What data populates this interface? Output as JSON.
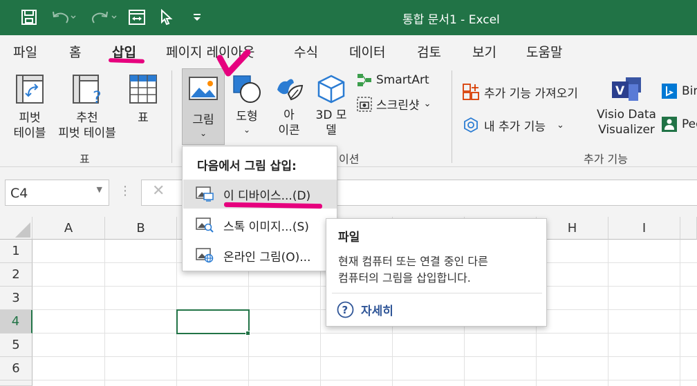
{
  "window": {
    "title": "통합 문서1  -  Excel"
  },
  "tabs": [
    {
      "label": "파일"
    },
    {
      "label": "홈"
    },
    {
      "label": "삽입"
    },
    {
      "label": "페이지 레이아웃"
    },
    {
      "label": "수식"
    },
    {
      "label": "데이터"
    },
    {
      "label": "검토"
    },
    {
      "label": "보기"
    },
    {
      "label": "도움말"
    }
  ],
  "ribbon": {
    "pivot_label": "피벗\n테이블",
    "recommended_label": "추천\n피벗 테이블",
    "table_label": "표",
    "group_table": "표",
    "pictures_label": "그림",
    "shapes_label": "도형",
    "icons_label": "아\n이콘",
    "model3d_label": "3D 모\n델",
    "smartart_label": "SmartArt",
    "screenshot_label": "스크린샷",
    "group_illustrations_suffix": "이션",
    "get_addins_label": "추가 기능 가져오기",
    "my_addins_label": "내 추가 기능",
    "visio_label": "Visio Data\nVisualizer",
    "bing_label": "Bin",
    "people_label": "Peo",
    "group_addins": "추가 기능"
  },
  "formula_bar": {
    "name_box": "C4"
  },
  "columns": [
    "A",
    "B",
    "H",
    "I"
  ],
  "rows": [
    "1",
    "2",
    "3",
    "4",
    "5",
    "6"
  ],
  "dropdown": {
    "header": "다음에서 그림 삽입:",
    "items": [
      {
        "label": "이 디바이스...(D)"
      },
      {
        "label": "스톡 이미지...(S)"
      },
      {
        "label": "온라인 그림(O)..."
      }
    ]
  },
  "tooltip": {
    "title": "파일",
    "body": "현재 컴퓨터 또는 연결 중인 다른\n컴퓨터의 그림을 삽입합니다.",
    "more": "자세히"
  },
  "colors": {
    "excel_green": "#217346",
    "highlight": "#e6007e"
  }
}
